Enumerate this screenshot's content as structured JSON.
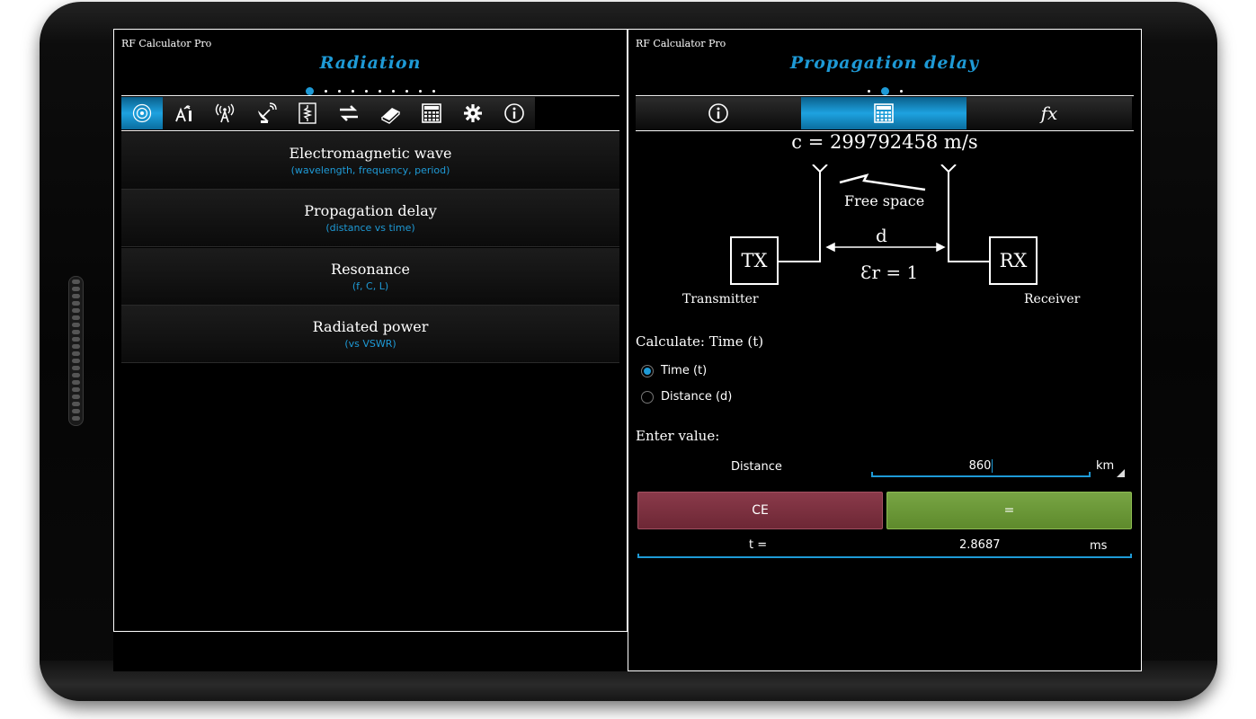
{
  "left": {
    "app_title": "RF Calculator Pro",
    "section_title": "Radiation",
    "dots": {
      "count": 10,
      "active": 0
    },
    "toolbar_icons": [
      "antenna-radiation-icon",
      "tower-icon",
      "broadcast-icon",
      "satellite-dish-icon",
      "resistor-icon",
      "convert-arrows-icon",
      "book-icon",
      "calculator-icon",
      "gear-icon",
      "info-icon"
    ],
    "toolbar_active": 0,
    "menu": [
      {
        "title": "Electromagnetic wave",
        "subtitle": "(wavelength, frequency, period)"
      },
      {
        "title": "Propagation delay",
        "subtitle": "(distance vs time)"
      },
      {
        "title": "Resonance",
        "subtitle": "(f, C, L)"
      },
      {
        "title": "Radiated power",
        "subtitle": "(vs VSWR)"
      }
    ]
  },
  "right": {
    "app_title": "RF Calculator Pro",
    "section_title": "Propagation delay",
    "dots": {
      "count": 3,
      "active": 1
    },
    "tabs": [
      {
        "icon": "info-icon",
        "glyph": "ⓘ"
      },
      {
        "icon": "calculator-icon",
        "glyph": "▦"
      },
      {
        "icon": "formula-icon",
        "glyph": "fx"
      }
    ],
    "tab_active": 1,
    "formula": "c = 299792458 m/s",
    "diagram": {
      "tx": "TX",
      "rx": "RX",
      "medium": "Free space",
      "distance": "d",
      "permittivity": "Ɛr = 1",
      "transmitter": "Transmitter",
      "receiver": "Receiver"
    },
    "calculate_label": "Calculate: Time (t)",
    "options": [
      {
        "label": "Time (t)",
        "selected": true
      },
      {
        "label": "Distance (d)",
        "selected": false
      }
    ],
    "enter_value_label": "Enter value:",
    "input": {
      "label": "Distance",
      "value": "860",
      "unit": "km"
    },
    "buttons": {
      "clear": "CE",
      "calculate": "="
    },
    "result": {
      "label": "t =",
      "value": "2.8687",
      "unit": "ms"
    }
  },
  "colors": {
    "accent": "#1e9ad6",
    "clear_button": "#7a2f3e",
    "calc_button": "#6b9838"
  }
}
